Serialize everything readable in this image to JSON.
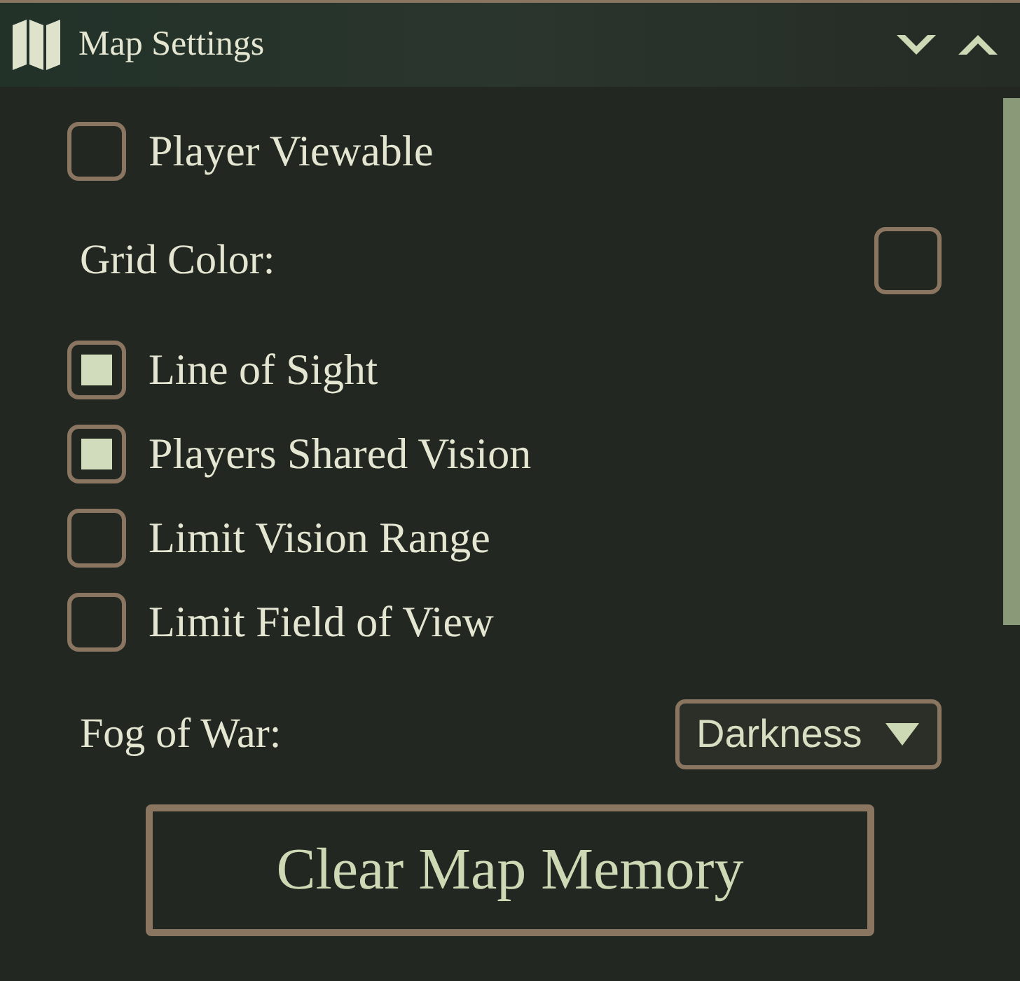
{
  "header": {
    "title": "Map Settings"
  },
  "settings": [
    {
      "kind": "checkbox",
      "label": "Player Viewable",
      "checked": false
    },
    {
      "kind": "color",
      "label": "Grid Color:"
    },
    {
      "kind": "checkbox",
      "label": "Line of Sight",
      "checked": true
    },
    {
      "kind": "checkbox",
      "label": "Players Shared Vision",
      "checked": true
    },
    {
      "kind": "checkbox",
      "label": "Limit Vision Range",
      "checked": false
    },
    {
      "kind": "checkbox",
      "label": "Limit Field of View",
      "checked": false
    },
    {
      "kind": "select",
      "label": "Fog of War:",
      "value": "Darkness"
    }
  ],
  "button": {
    "label": "Clear Map Memory"
  }
}
